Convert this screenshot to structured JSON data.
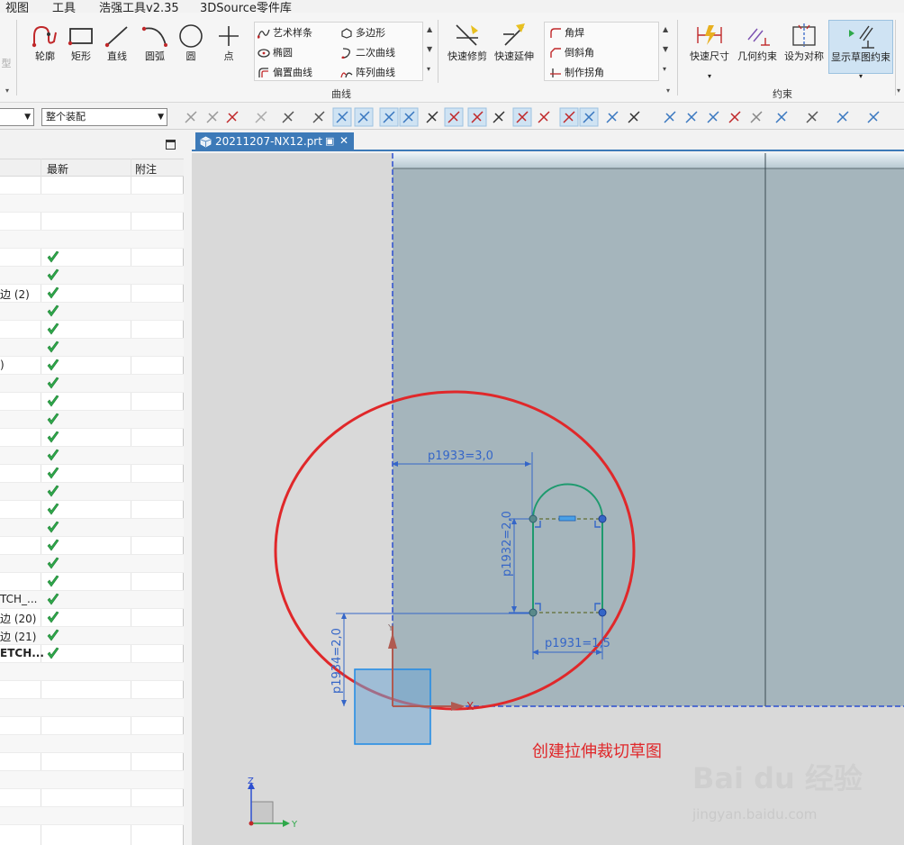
{
  "menu": [
    "视图",
    "工具",
    "浩强工具v2.35",
    "3DSource零件库"
  ],
  "ribbon": {
    "cut_left_label": "型",
    "curve_buttons": [
      "轮廓",
      "矩形",
      "直线",
      "圆弧",
      "圆",
      "点"
    ],
    "curve_small_col1": [
      "艺术样条",
      "椭圆",
      "偏置曲线"
    ],
    "curve_small_col2": [
      "多边形",
      "二次曲线",
      "阵列曲线"
    ],
    "edit_buttons": [
      "快速修剪",
      "快速延伸"
    ],
    "corner_small": [
      "角焊",
      "倒斜角",
      "制作拐角"
    ],
    "group_curve": "曲线",
    "constraint_buttons": [
      "快速尺寸",
      "几何约束",
      "设为对称",
      "显示草图约束"
    ],
    "group_constraint": "约束"
  },
  "toolbar": {
    "assembly_combo": "整个装配"
  },
  "nav": {
    "columns": [
      "最新",
      "附注"
    ],
    "rows": [
      {
        "name": "",
        "check": false
      },
      {
        "name": "",
        "check": false
      },
      {
        "name": "",
        "check": false
      },
      {
        "name": "",
        "check": false
      },
      {
        "name": "",
        "check": true
      },
      {
        "name": "",
        "check": true
      },
      {
        "name": "边 (2)",
        "check": true
      },
      {
        "name": "",
        "check": true
      },
      {
        "name": "",
        "check": true
      },
      {
        "name": "",
        "check": true
      },
      {
        "name": ")",
        "check": true
      },
      {
        "name": "",
        "check": true
      },
      {
        "name": "",
        "check": true
      },
      {
        "name": "",
        "check": true
      },
      {
        "name": "",
        "check": true
      },
      {
        "name": "",
        "check": true
      },
      {
        "name": "",
        "check": true
      },
      {
        "name": "",
        "check": true
      },
      {
        "name": "",
        "check": true
      },
      {
        "name": "",
        "check": true
      },
      {
        "name": "",
        "check": true
      },
      {
        "name": "",
        "check": true
      },
      {
        "name": "",
        "check": true
      },
      {
        "name": "TCH_...",
        "check": true
      },
      {
        "name": "边 (20)",
        "check": true
      },
      {
        "name": "边 (21)",
        "check": true
      },
      {
        "name": "ETCH...",
        "check": true,
        "bold": true
      },
      {
        "name": "",
        "check": false
      },
      {
        "name": "",
        "check": false
      },
      {
        "name": "",
        "check": false
      },
      {
        "name": "",
        "check": false
      },
      {
        "name": "",
        "check": false
      },
      {
        "name": "",
        "check": false
      },
      {
        "name": "",
        "check": false
      },
      {
        "name": "",
        "check": false
      },
      {
        "name": "",
        "check": false
      }
    ]
  },
  "tab": {
    "title": "20211207-NX12.prt"
  },
  "sketch": {
    "dim_p1933": "p1933=3,0",
    "dim_p1932": "p1932=2,0",
    "dim_p1931": "p1931=1,5",
    "dim_p1934": "p1934=2,0",
    "axis_x": "X",
    "axis_y": "Y",
    "triad_z": "Z",
    "triad_y": "Y"
  },
  "annotation": "创建拉伸裁切草图",
  "watermark": {
    "logo": "Bai du 经验",
    "url": "jingyan.baidu.com"
  },
  "colors": {
    "accent": "#3d7ab8",
    "sketch_green": "#1e9a6e",
    "dim_blue": "#3566c8",
    "annotation_red": "#e0282a",
    "check_green": "#2ea84a"
  }
}
